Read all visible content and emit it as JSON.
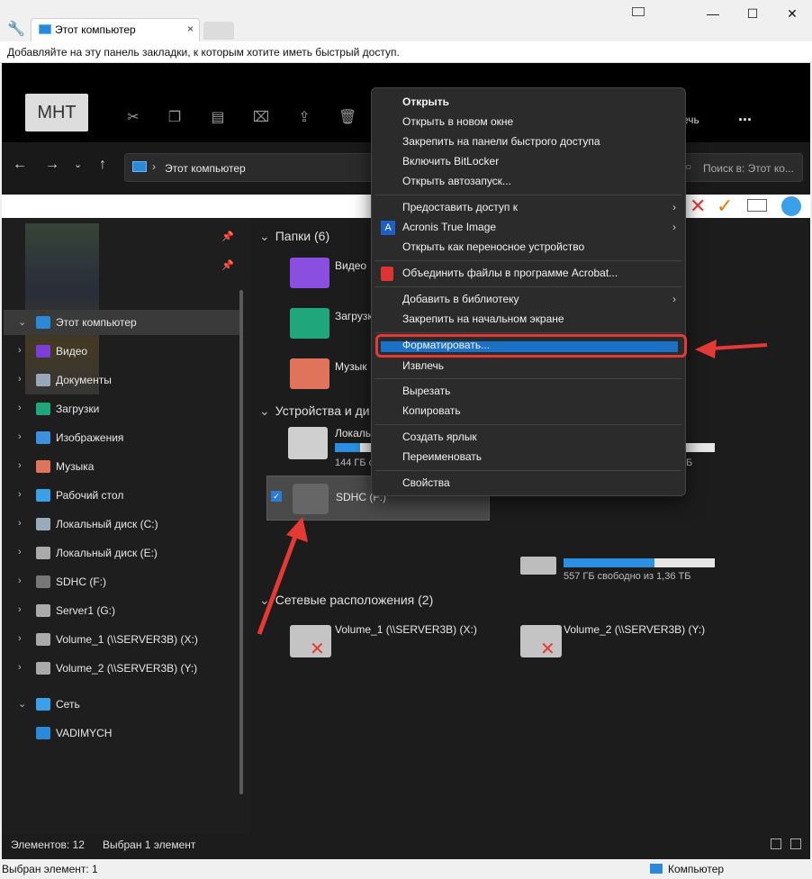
{
  "browser": {
    "tab_title": "Этот компьютер",
    "tab_close": "×",
    "bookmarks_hint": "Добавляйте на эту панель закладки, к которым хотите иметь быстрый доступ.",
    "window_controls": [
      "—",
      "☐",
      "✕"
    ]
  },
  "toolbar": {
    "mht_label": "MHT",
    "more_label": "...",
    "partial_label": "ечь"
  },
  "address": {
    "path": "Этот компьютер",
    "search_placeholder": "Поиск в: Этот ко..."
  },
  "sidebar": {
    "items": [
      {
        "label": "Этот компьютер",
        "icon": "monitor-icon",
        "color": "#2b8ad8"
      },
      {
        "label": "Видео",
        "icon": "video-folder-icon",
        "color": "#7b3fd8"
      },
      {
        "label": "Документы",
        "icon": "documents-icon",
        "color": "#9aa7b8"
      },
      {
        "label": "Загрузки",
        "icon": "downloads-icon",
        "color": "#1fa67a"
      },
      {
        "label": "Изображения",
        "icon": "pictures-icon",
        "color": "#3d8fe0"
      },
      {
        "label": "Музыка",
        "icon": "music-icon",
        "color": "#e0745a"
      },
      {
        "label": "Рабочий стол",
        "icon": "desktop-icon",
        "color": "#3aa0e8"
      },
      {
        "label": "Локальный диск (C:)",
        "icon": "drive-c-icon",
        "color": "#9ab"
      },
      {
        "label": "Локальный диск (E:)",
        "icon": "drive-e-icon",
        "color": "#aaa"
      },
      {
        "label": "SDHC (F:)",
        "icon": "sd-card-icon",
        "color": "#777"
      },
      {
        "label": "Server1 (G:)",
        "icon": "network-drive-icon",
        "color": "#aaa"
      },
      {
        "label": "Volume_1 (\\\\SERVER3B) (X:)",
        "icon": "network-disconnected-icon",
        "color": "#aaa"
      },
      {
        "label": "Volume_2 (\\\\SERVER3B) (Y:)",
        "icon": "network-disconnected-icon",
        "color": "#aaa"
      },
      {
        "label": "Сеть",
        "icon": "network-icon",
        "color": "#3aa0e8"
      },
      {
        "label": "VADIMYCH",
        "icon": "computer-icon",
        "color": "#2b8ad8"
      }
    ]
  },
  "content": {
    "folders_header": "Папки (6)",
    "devices_header": "Устройства и ди",
    "network_header": "Сетевые расположения (2)",
    "folders": [
      {
        "label": "Видео",
        "color": "#8a4ee0"
      },
      {
        "label": "Загрузк",
        "color": "#1fa67a"
      },
      {
        "label": "Музык",
        "color": "#e0745a"
      }
    ],
    "drives": [
      {
        "label": "Локаль",
        "sub": "144 ГБ с",
        "sub_right": "Б",
        "fill": 0.66
      },
      {
        "label": "SDHC (F:)",
        "sub": "",
        "sub_right": "",
        "fill": 0
      },
      {
        "label": "",
        "sub": "557 ГБ свободно из 1,36 ТБ",
        "sub_right": "",
        "fill": 0.6
      }
    ],
    "network": [
      {
        "label": "Volume_1 (\\\\SERVER3B) (X:)"
      },
      {
        "label": "Volume_2 (\\\\SERVER3B) (Y:)"
      }
    ]
  },
  "context_menu": {
    "items": [
      {
        "label": "Открыть",
        "bold": true
      },
      {
        "label": "Открыть в новом окне"
      },
      {
        "label": "Закрепить на панели быстрого доступа"
      },
      {
        "label": "Включить BitLocker"
      },
      {
        "label": "Открыть автозапуск..."
      },
      {
        "label": "Предоставить доступ к",
        "submenu": true
      },
      {
        "label": "Acronis True Image",
        "submenu": true
      },
      {
        "label": "Открыть как переносное устройство"
      },
      {
        "label": "Объединить файлы в программе Acrobat..."
      },
      {
        "label": "Добавить в библиотеку",
        "submenu": true
      },
      {
        "label": "Закрепить на начальном экране"
      },
      {
        "label": "Форматировать..."
      },
      {
        "label": "Извлечь"
      },
      {
        "label": "Вырезать"
      },
      {
        "label": "Копировать"
      },
      {
        "label": "Создать ярлык"
      },
      {
        "label": "Переименовать"
      },
      {
        "label": "Свойства"
      }
    ],
    "submenu_glyph": "›"
  },
  "status": {
    "count": "Элементов: 12",
    "selected": "Выбран 1 элемент",
    "bottom_left": "Выбран элемент: 1",
    "bottom_right": "Компьютер"
  },
  "colors": {
    "accent": "#1b70c8",
    "highlight_red": "#e53935"
  }
}
